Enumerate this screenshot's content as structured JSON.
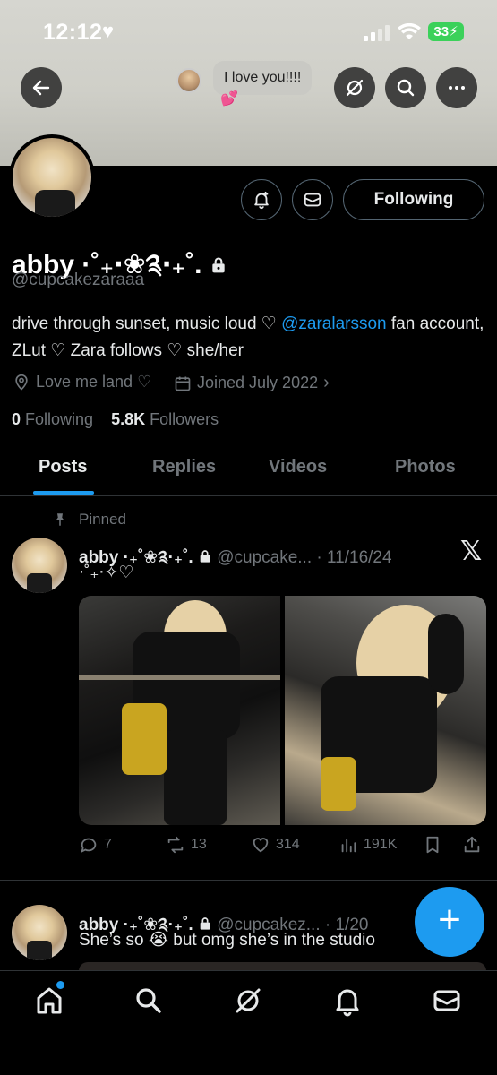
{
  "status_bar": {
    "time": "12:12",
    "battery": "33"
  },
  "top_bar": {
    "bubble_text": "I love you!!!!",
    "bubble_emoji": "💕"
  },
  "profile": {
    "display_name": "abby ·˚₊‧❀༉‧₊˚.",
    "handle": "@cupcakezaraaa",
    "bio_before": "drive through sunset, music loud ♡ ",
    "bio_link": "@zaralarsson",
    "bio_after": " fan account, ZLut ♡ Zara follows ♡ she/her",
    "location": "Love me land ♡",
    "joined": "Joined July 2022",
    "following_count": "0",
    "following_label": "Following",
    "followers_count": "5.8K",
    "followers_label": "Followers",
    "follow_button": "Following"
  },
  "tabs": [
    "Posts",
    "Replies",
    "Videos",
    "Photos"
  ],
  "posts": [
    {
      "pinned_label": "Pinned",
      "name": "abby ·₊˚❀༉·₊˚.",
      "handle_date": "@cupcake... · 11/16/24",
      "text": "⋅˚₊‧✧♡",
      "replies": "7",
      "reposts": "13",
      "likes": "314",
      "views": "191K"
    },
    {
      "name": "abby ·₊˚❀༉·₊˚.",
      "handle_date": "@cupcakez... · 1/20",
      "text_before": "She’s so ",
      "emoji": "😭",
      "text_after": " but omg she’s in the studio"
    }
  ],
  "colors": {
    "accent": "#1d9bf0",
    "muted": "#71767b",
    "text": "#e7e9ea",
    "background": "#000000"
  }
}
